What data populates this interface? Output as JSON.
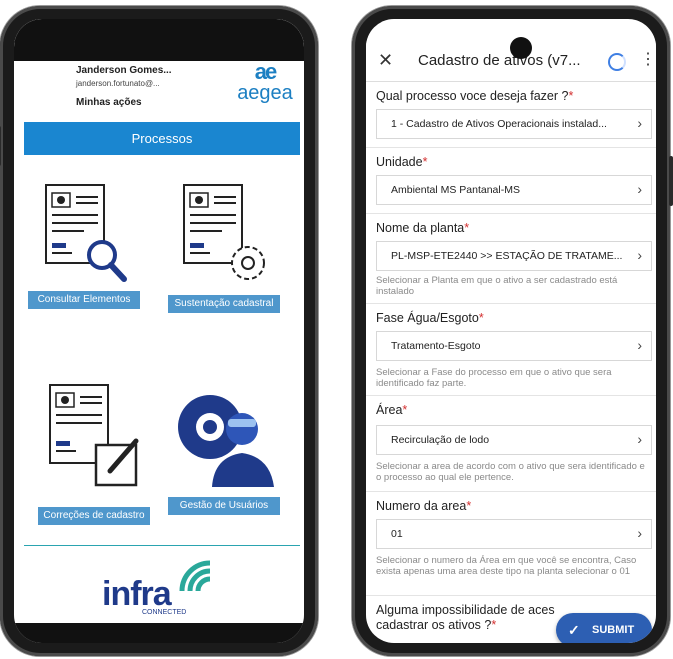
{
  "left": {
    "user": {
      "name": "Janderson Gomes...",
      "email": "janderson.fortunato@...",
      "menu": "Minhas ações"
    },
    "logo": {
      "mark": "ae",
      "word": "aegea"
    },
    "section_title": "Processos",
    "tiles": [
      {
        "label": "Consultar Elementos"
      },
      {
        "label": "Sustentação cadastral"
      },
      {
        "label": "Correções de cadastro"
      },
      {
        "label": "Gestão de Usuários"
      }
    ],
    "brand": {
      "word": "infra",
      "sub": "CONNECTED"
    }
  },
  "right": {
    "header": {
      "title": "Cadastro de ativos (v7...",
      "close_icon": "close-icon",
      "more_icon": "more-vertical-icon"
    },
    "questions": [
      {
        "label": "Qual processo voce deseja fazer ?",
        "value": "1 - Cadastro de Ativos Operacionais instalad...",
        "hint": ""
      },
      {
        "label": "Unidade",
        "value": "Ambiental MS Pantanal-MS",
        "hint": ""
      },
      {
        "label": "Nome da planta",
        "value": "PL-MSP-ETE2440 >> ESTAÇÃO DE TRATAME...",
        "hint": "Selecionar a Planta em que o ativo a ser cadastrado está instalado"
      },
      {
        "label": "Fase Água/Esgoto",
        "value": "Tratamento-Esgoto",
        "hint": "Selecionar a Fase do processo em que o ativo que sera identificado faz parte."
      },
      {
        "label": "Área",
        "value": "Recirculação de lodo",
        "hint": "Selecionar a area de acordo com o ativo que sera identificado e o processo ao qual ele pertence."
      },
      {
        "label": "Numero da area",
        "value": "01",
        "hint": "Selecionar o numero da Área em que você se encontra, Caso exista apenas uma area deste tipo na planta selecionar o 01"
      },
      {
        "label": "Alguma impossibilidade de aces cadastrar os ativos ?",
        "value": "",
        "hint": ""
      }
    ],
    "required_mark": "*",
    "submit": {
      "label": "SUBMIT"
    },
    "colors": {
      "accent": "#2d5fb3",
      "required": "#d32f2f",
      "process_bar": "#1a86d0",
      "tile_label": "#4f97cc",
      "brand_blue": "#1c7fc2"
    }
  }
}
